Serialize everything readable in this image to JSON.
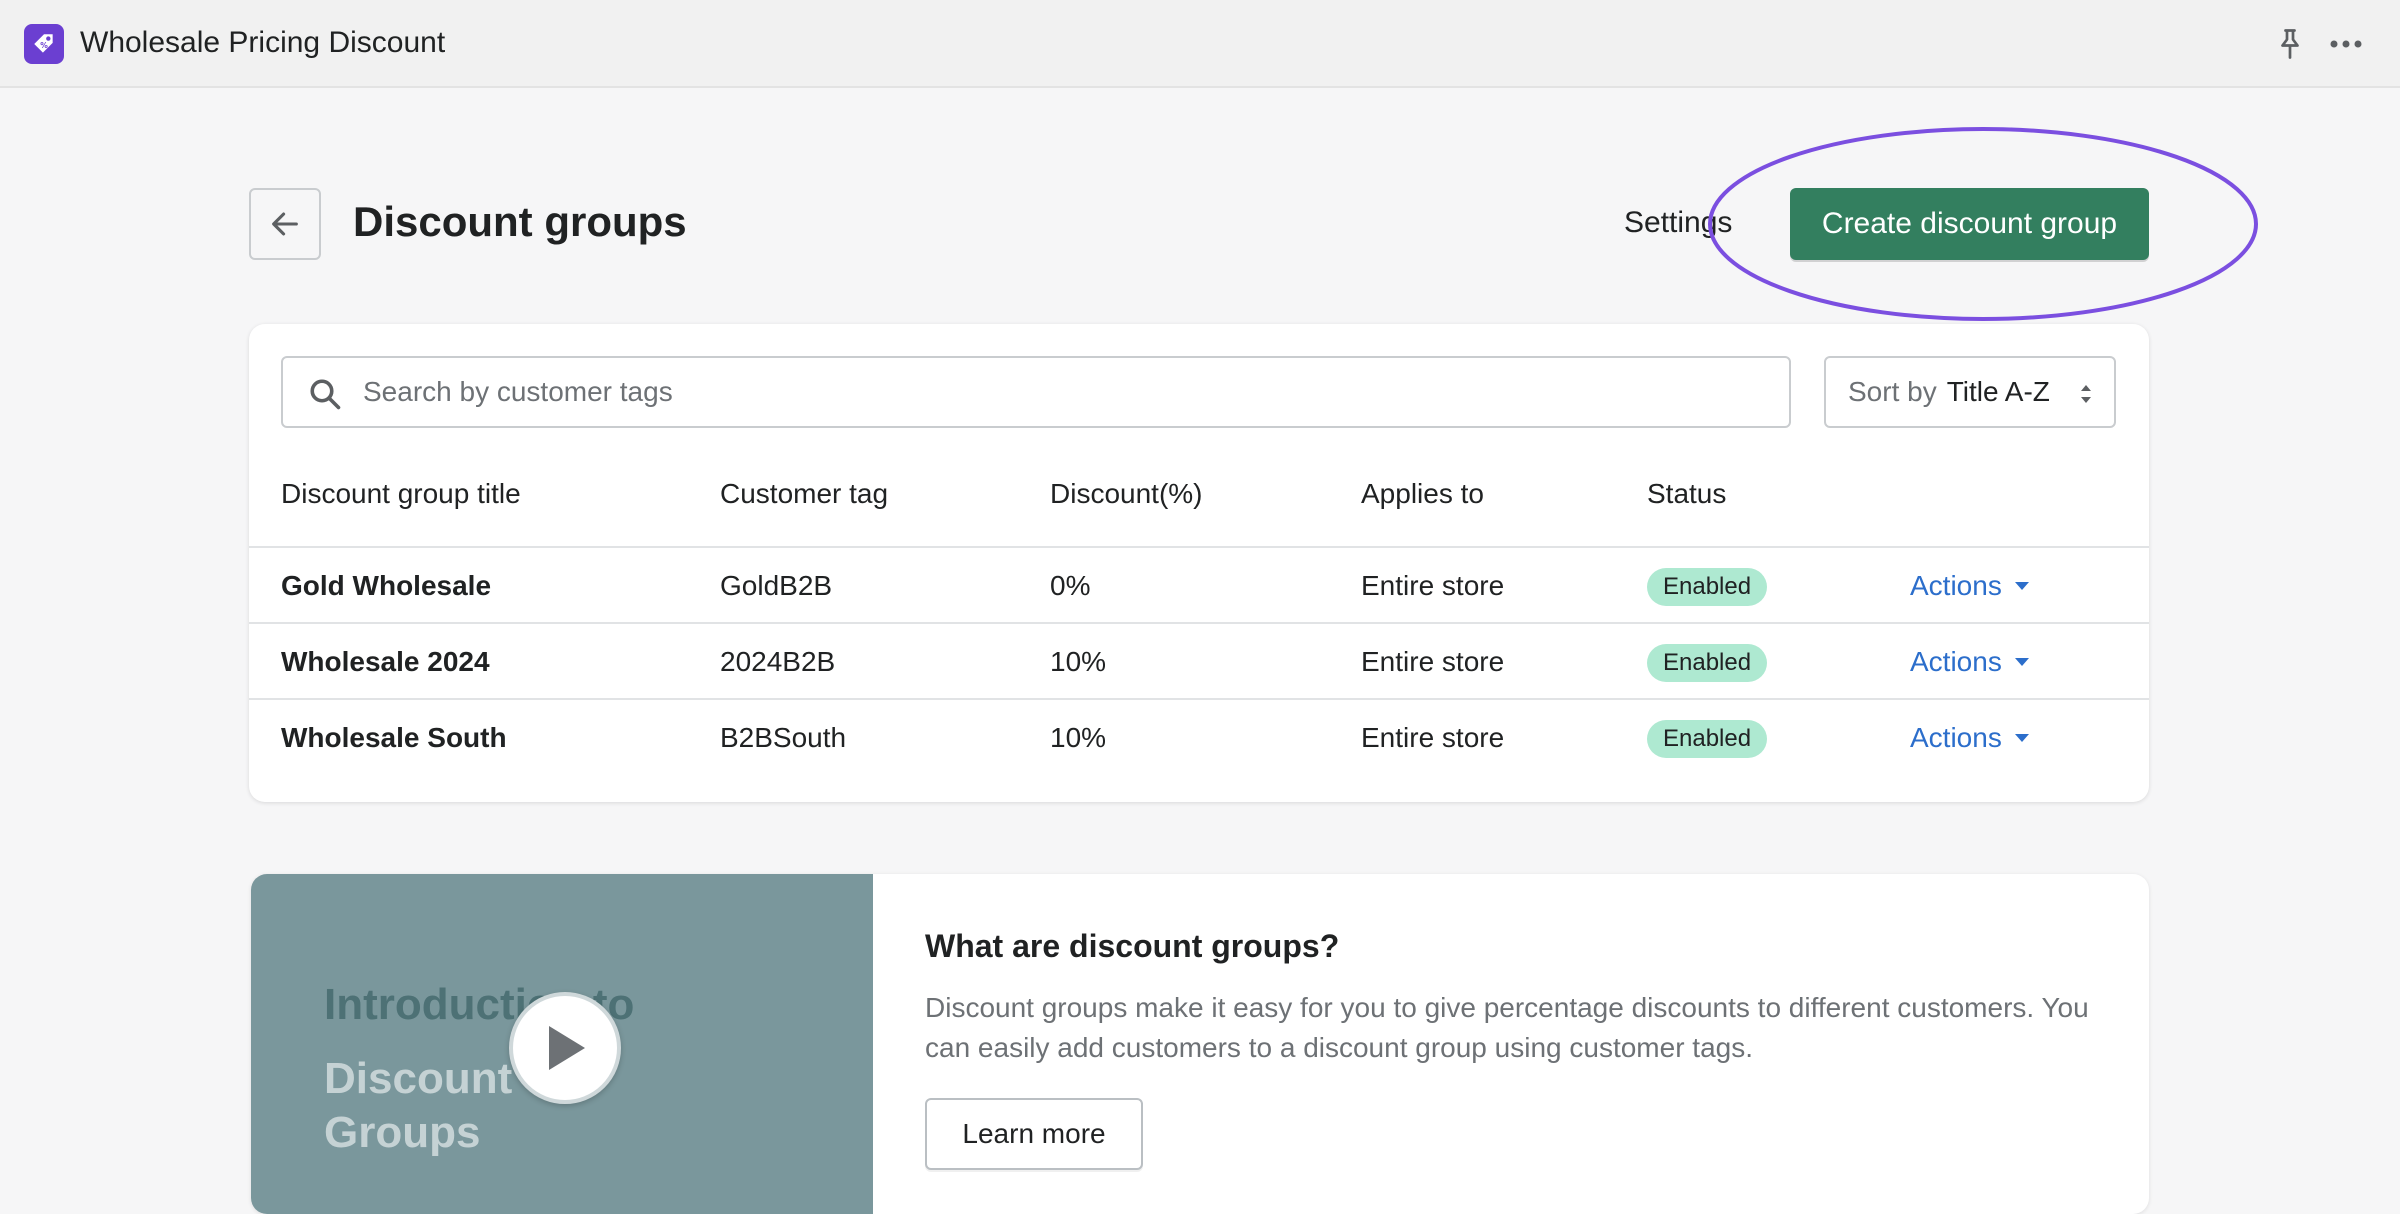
{
  "app": {
    "title": "Wholesale Pricing Discount",
    "icon": "tag-icon",
    "accent": "#6b3fd1"
  },
  "header": {
    "title": "Discount groups",
    "settings_label": "Settings",
    "create_label": "Create discount group",
    "primary_color": "#337f5f",
    "highlight_color": "#7b4fe0"
  },
  "search": {
    "placeholder": "Search by customer tags",
    "value": ""
  },
  "sort": {
    "prefix": "Sort by",
    "value": "Title A-Z"
  },
  "table": {
    "columns": [
      "Discount group title",
      "Customer tag",
      "Discount(%)",
      "Applies to",
      "Status"
    ],
    "rows": [
      {
        "title": "Gold Wholesale",
        "tag": "GoldB2B",
        "discount": "0%",
        "applies_to": "Entire store",
        "status": "Enabled",
        "action": "Actions"
      },
      {
        "title": "Wholesale 2024",
        "tag": "2024B2B",
        "discount": "10%",
        "applies_to": "Entire store",
        "status": "Enabled",
        "action": "Actions"
      },
      {
        "title": "Wholesale South",
        "tag": "B2BSouth",
        "discount": "10%",
        "applies_to": "Entire store",
        "status": "Enabled",
        "action": "Actions"
      }
    ]
  },
  "info": {
    "video_line1": "Introduction to",
    "video_line2": "Discount Groups",
    "title": "What are discount groups?",
    "description": "Discount groups make it easy for you to give percentage discounts to different customers. You can easily add customers to a discount group using customer tags.",
    "learn_more": "Learn more"
  }
}
